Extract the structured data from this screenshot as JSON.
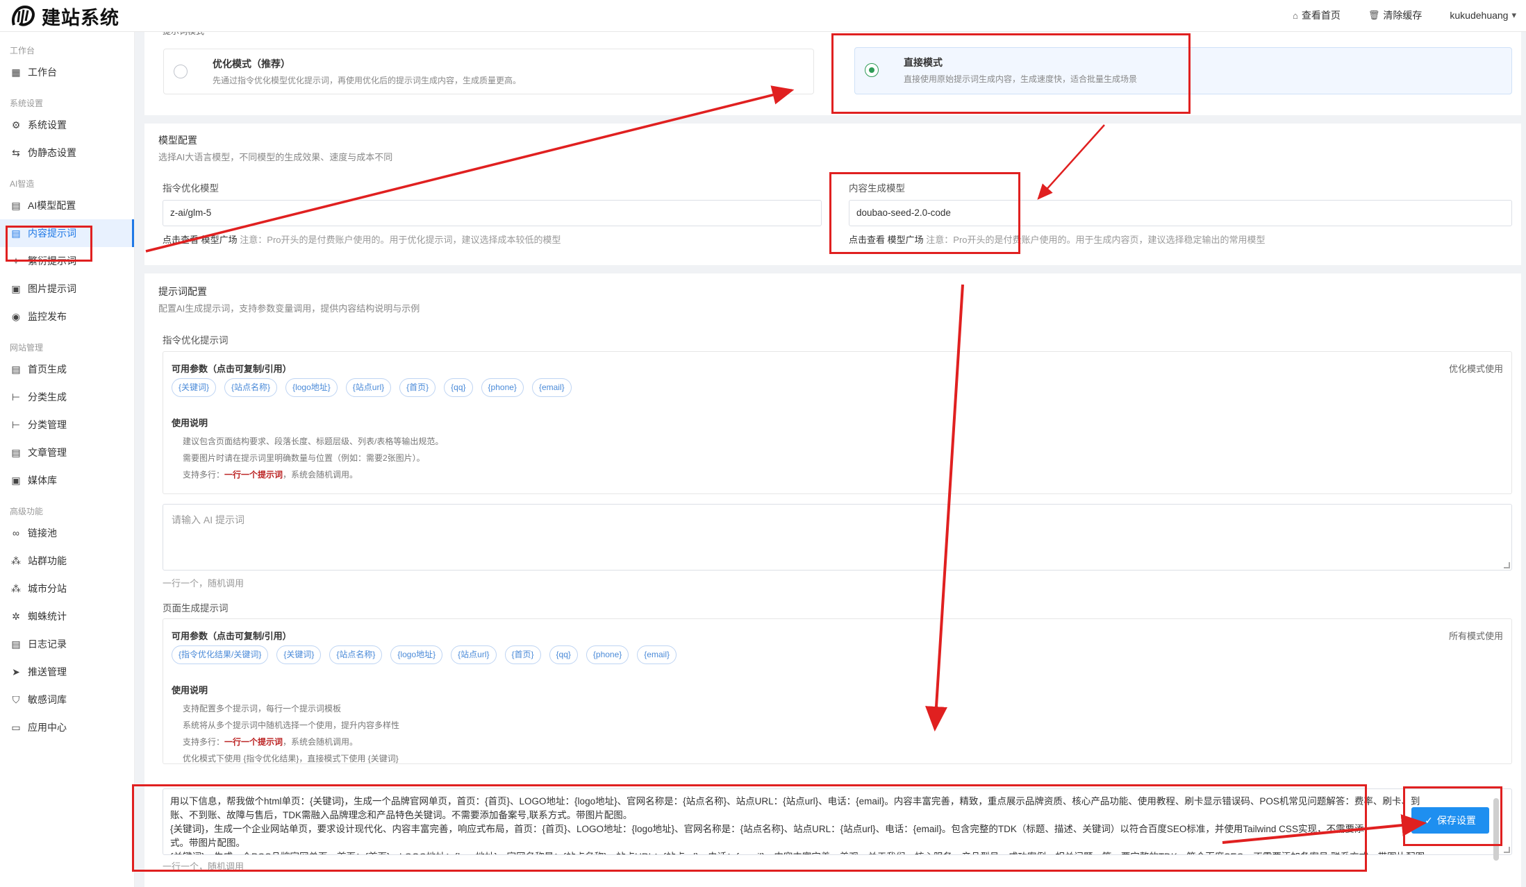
{
  "header": {
    "logo_text": "建站系统",
    "links": [
      {
        "icon": "home-icon",
        "label": "查看首页"
      },
      {
        "icon": "trash-icon",
        "label": "清除缓存"
      },
      {
        "icon": "user-icon",
        "label": "kukudehuang"
      }
    ]
  },
  "sidebar": {
    "sections": [
      {
        "title": "工作台",
        "items": [
          {
            "icon": "dashboard-icon",
            "label": "工作台"
          }
        ]
      },
      {
        "title": "系统设置",
        "items": [
          {
            "icon": "gear-icon",
            "label": "系统设置"
          },
          {
            "icon": "route-icon",
            "label": "伪静态设置"
          }
        ]
      },
      {
        "title": "AI智造",
        "items": [
          {
            "icon": "document-icon",
            "label": "AI模型配置"
          },
          {
            "icon": "document-icon",
            "label": "内容提示词",
            "active": true
          },
          {
            "icon": "sparkle-icon",
            "label": "繁衍提示词"
          },
          {
            "icon": "image-icon",
            "label": "图片提示词"
          },
          {
            "icon": "eye-icon",
            "label": "监控发布"
          }
        ]
      },
      {
        "title": "网站管理",
        "items": [
          {
            "icon": "document-icon",
            "label": "首页生成"
          },
          {
            "icon": "tree-icon",
            "label": "分类生成"
          },
          {
            "icon": "tree-icon",
            "label": "分类管理"
          },
          {
            "icon": "document-icon",
            "label": "文章管理"
          },
          {
            "icon": "image-icon",
            "label": "媒体库"
          }
        ]
      },
      {
        "title": "高级功能",
        "items": [
          {
            "icon": "link-icon",
            "label": "链接池"
          },
          {
            "icon": "network-icon",
            "label": "站群功能"
          },
          {
            "icon": "network-icon",
            "label": "城市分站"
          },
          {
            "icon": "spider-icon",
            "label": "蜘蛛统计"
          },
          {
            "icon": "document-icon",
            "label": "日志记录"
          },
          {
            "icon": "send-icon",
            "label": "推送管理"
          },
          {
            "icon": "shield-icon",
            "label": "敏感词库"
          },
          {
            "icon": "app-icon",
            "label": "应用中心"
          }
        ]
      }
    ]
  },
  "modes": {
    "section_label": "提示词模式",
    "optimize": {
      "title": "优化模式（推荐）",
      "desc": "先通过指令优化模型优化提示词，再使用优化后的提示词生成内容，生成质量更高。",
      "selected": false
    },
    "direct": {
      "title": "直接模式",
      "desc": "直接使用原始提示词生成内容，生成速度快，适合批量生成场景",
      "selected": true
    }
  },
  "model_config": {
    "title": "模型配置",
    "subtitle": "选择AI大语言模型，不同模型的生成效果、速度与成本不同",
    "optimize_label": "指令优化模型",
    "optimize_value": "z-ai/glm-5",
    "optimize_hint_prefix": "点击查看",
    "optimize_hint_link": "模型广场",
    "optimize_hint_rest": "注意：Pro开头的是付费账户使用的。用于优化提示词，建议选择成本较低的模型",
    "content_label": "内容生成模型",
    "content_value": "doubao-seed-2.0-code",
    "content_hint_prefix": "点击查看",
    "content_hint_link": "模型广场",
    "content_hint_rest": "注意：Pro开头的是付费账户使用的。用于生成内容页，建议选择稳定输出的常用模型"
  },
  "prompt_config": {
    "title": "提示词配置",
    "subtitle": "配置AI生成提示词，支持参数变量调用，提供内容结构说明与示例",
    "optimize_section": {
      "label": "指令优化提示词",
      "params_title": "可用参数（点击可复制/引用）",
      "right_note": "优化模式使用",
      "tags": [
        "{关键词}",
        "{站点名称}",
        "{logo地址}",
        "{站点url}",
        "{首页}",
        "{qq}",
        "{phone}",
        "{email}"
      ],
      "usage_title": "使用说明",
      "usage_lines": [
        "建议包含页面结构要求、段落长度、标题层级、列表/表格等输出规范。",
        "需要图片时请在提示词里明确数量与位置（例如：需要2张图片）。"
      ],
      "multi_prefix": "支持多行：",
      "multi_red": "一行一个提示词",
      "multi_suffix": "，系统会随机调用。",
      "placeholder": "请输入 AI 提示词",
      "below": "一行一个，随机调用"
    },
    "page_section": {
      "label": "页面生成提示词",
      "params_title": "可用参数（点击可复制/引用）",
      "right_note": "所有模式使用",
      "tags": [
        "{指令优化结果/关键词}",
        "{关键词}",
        "{站点名称}",
        "{logo地址}",
        "{站点url}",
        "{首页}",
        "{qq}",
        "{phone}",
        "{email}"
      ],
      "usage_title": "使用说明",
      "usage_lines": [
        "支持配置多个提示词，每行一个提示词模板",
        "系统将从多个提示词中随机选择一个使用，提升内容多样性"
      ],
      "multi_prefix": "支持多行：",
      "multi_red": "一行一个提示词",
      "multi_suffix": "，系统会随机调用。",
      "usage_last": "优化模式下使用 {指令优化结果}，直接模式下使用 {关键词}",
      "text_lines": [
        "用以下信息，帮我做个html单页：{关键词}，生成一个品牌官网单页，首页：{首页}、LOGO地址：{logo地址}、官网名称是：{站点名称}、站点URL：{站点url}、电话：{email}。内容丰富完善，精致，重点展示品牌资质、核心产品功能、使用教程、刷卡显示错误码、POS机常见问题解答：费率、刷卡、到",
        "账、不到账、故障与售后，TDK需融入品牌理念和产品特色关键词。不需要添加备案号,联系方式。带图片配图。",
        "{关键词}，生成一个企业网站单页，要求设计现代化、内容丰富完善，响应式布局，首页：{首页}、LOGO地址：{logo地址}、官网名称是：{站点名称}、站点URL：{站点url}、电话：{email}。包含完整的TDK（标题、描述、关键词）以符合百度SEO标准，并使用Tailwind CSS实现，不需要添",
        "式。带图片配图。",
        "{关键词}，生成一个POS品牌官网单页，首页：{首页}、LOGO地址：{logo地址}、官网名称是：{站点名称}、站点URL：{站点url}、电话：{email}。内容丰富完善，美观，关于我们、核心服务、产品型号、成功案例、相关问题、等，要完整的TDK，符合百度SEO，不需要添加备案号,联系方式，带图片配图。"
      ],
      "below": "一行一个，随机调用"
    }
  },
  "save_button": "保存设置",
  "annotation_color": "#e02020"
}
